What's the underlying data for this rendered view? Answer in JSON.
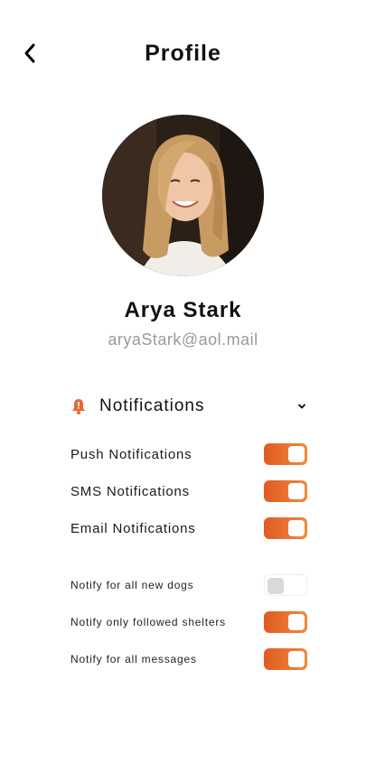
{
  "header": {
    "title": "Profile"
  },
  "profile": {
    "name": "Arya Stark",
    "email": "aryaStark@aol.mail"
  },
  "notifications": {
    "title": "Notifications",
    "items": [
      {
        "label": "Push Notifications",
        "on": true
      },
      {
        "label": "SMS Notifications",
        "on": true
      },
      {
        "label": "Email Notifications",
        "on": true
      }
    ],
    "options": [
      {
        "label": "Notify for all new dogs",
        "on": false
      },
      {
        "label": "Notify only followed shelters",
        "on": true
      },
      {
        "label": "Notify for all messages",
        "on": true
      }
    ]
  },
  "colors": {
    "accent": "#E8692D",
    "toggle_off_knob": "#D9D9D9",
    "email_text": "#9A9A9A"
  },
  "icons": {
    "back": "chevron-left-icon",
    "bell": "bell-icon",
    "expand": "chevron-down-icon"
  }
}
